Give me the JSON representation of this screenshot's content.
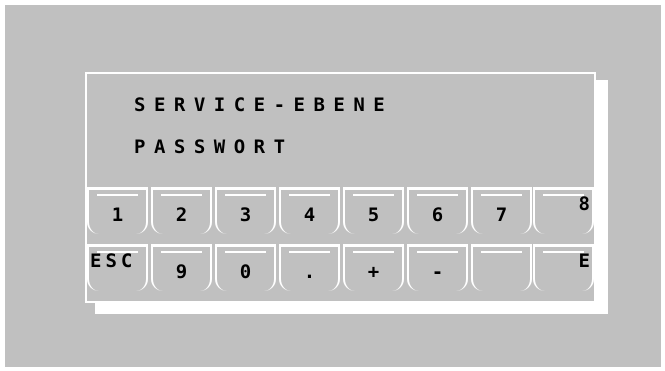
{
  "display": {
    "line1": "SERVICE-EBENE",
    "line2": "PASSWORT"
  },
  "keys_row1": [
    "1",
    "2",
    "3",
    "4",
    "5",
    "6",
    "7",
    "8"
  ],
  "keys_row2": [
    "ESC",
    "9",
    "0",
    ".",
    "+",
    "-",
    "",
    "E"
  ],
  "colors": {
    "background": "#c0c0c0",
    "border": "#ffffff",
    "text": "#000000"
  }
}
